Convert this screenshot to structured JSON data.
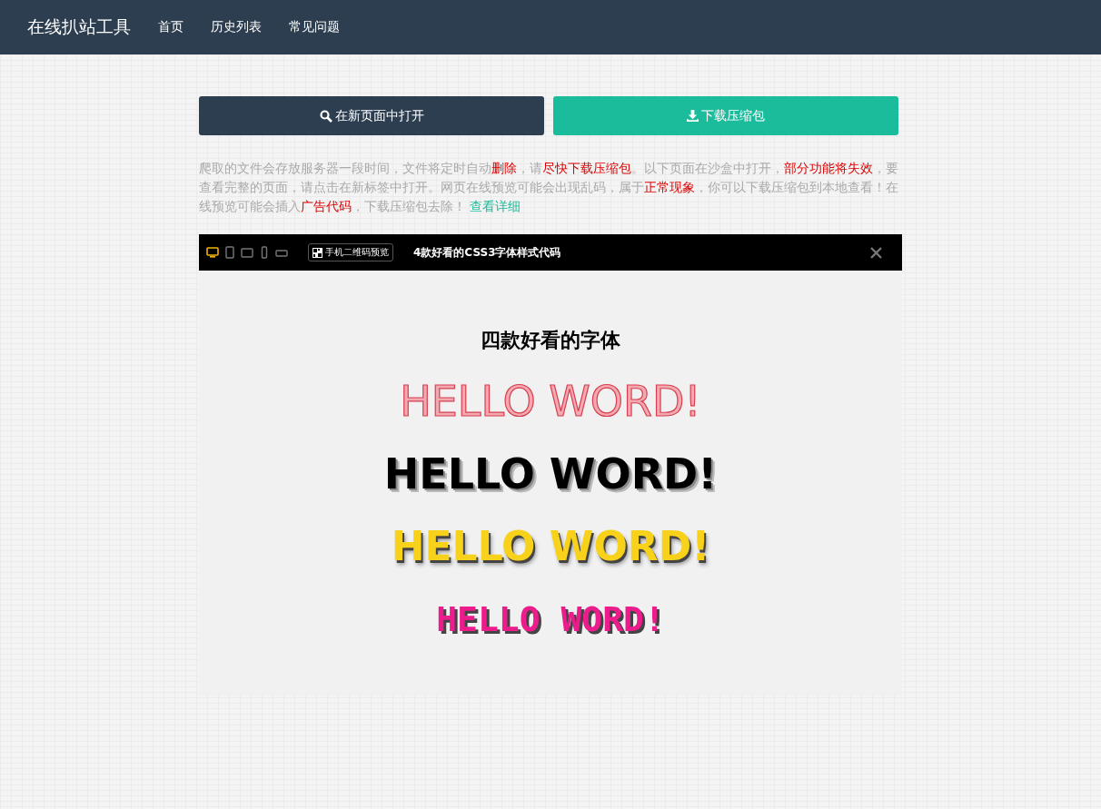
{
  "nav": {
    "brand": "在线扒站工具",
    "links": [
      "首页",
      "历史列表",
      "常见问题"
    ]
  },
  "actions": [
    {
      "kind": "open",
      "label": "在新页面中打开"
    },
    {
      "kind": "download",
      "label": "下载压缩包"
    }
  ],
  "notice": [
    {
      "kind": "plain",
      "text": "爬取的文件会存放服务器一段时间，文件将定时自动"
    },
    {
      "kind": "warn",
      "text": "删除"
    },
    {
      "kind": "plain",
      "text": "，请"
    },
    {
      "kind": "warn",
      "text": "尽快下载压缩包"
    },
    {
      "kind": "plain",
      "text": "。以下页面在沙盒中打开，"
    },
    {
      "kind": "warn",
      "text": "部分功能将失效"
    },
    {
      "kind": "plain",
      "text": "，要查看完整的页面，请点击在新标签中打开。网页在线预览可能会出现乱码，属于"
    },
    {
      "kind": "warn",
      "text": "正常现象"
    },
    {
      "kind": "plain",
      "text": "，你可以下载压缩包到本地查看！在线预览可能会插入"
    },
    {
      "kind": "warn",
      "text": "广告代码"
    },
    {
      "kind": "plain",
      "text": "，下载压缩包去除！ "
    },
    {
      "kind": "link",
      "text": "查看详细"
    }
  ],
  "preview": {
    "devices": [
      {
        "kind": "desktop",
        "selected": true
      },
      {
        "kind": "tablet",
        "selected": false
      },
      {
        "kind": "tablet-landscape",
        "selected": false
      },
      {
        "kind": "phone",
        "selected": false
      },
      {
        "kind": "phone-landscape",
        "selected": false
      }
    ],
    "qr_button": "手机二维码预览",
    "title": "4款好看的CSS3字体样式代码",
    "heading": "四款好看的字体",
    "samples": [
      {
        "kind": "outline",
        "text": "HELLO WORD!"
      },
      {
        "kind": "hatched",
        "text": "HELLO WORD!"
      },
      {
        "kind": "gold",
        "text": "HELLO WORD!"
      },
      {
        "kind": "pink",
        "text": "HELLO WORD!"
      }
    ]
  }
}
